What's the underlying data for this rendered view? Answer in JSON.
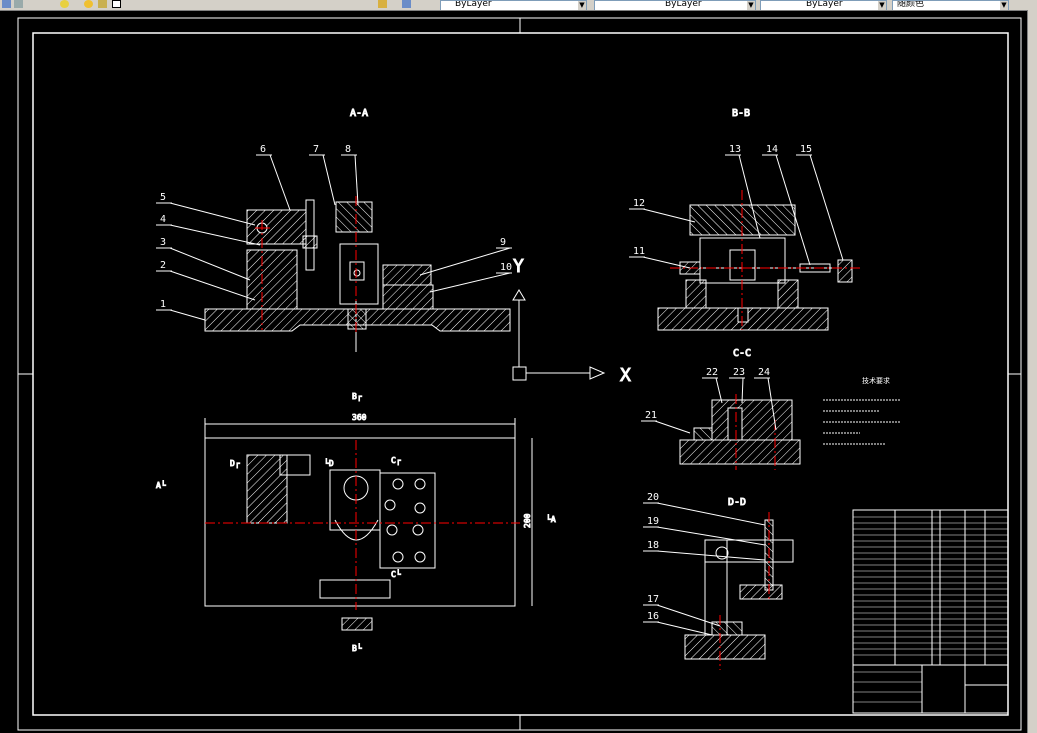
{
  "toolbar": {
    "layer_dropdown": "ByLayer",
    "color_dropdown": "ByLayer",
    "linetype_dropdown": "ByLayer",
    "lineweight_dropdown": "随颜色",
    "icons": [
      "layer-icon",
      "layer-state-icon",
      "lightbulb-icon",
      "sun-icon",
      "lock-icon",
      "color-swatch-icon",
      "match-properties-icon",
      "layer-previous-icon"
    ]
  },
  "views": {
    "aa": "A-A",
    "bb": "B-B",
    "cc": "C-C",
    "dd": "D-D",
    "b_top": "B┌",
    "b_bottom": "B└",
    "a_left": "A└",
    "a_right": "└A",
    "d_mark": "D┌",
    "d_mark2": "└D",
    "c_top": "C┌",
    "c_bottom": "C└"
  },
  "dimensions": {
    "width": "360",
    "height": "200"
  },
  "ucs": {
    "x": "X",
    "y": "Y"
  },
  "balloons": [
    "1",
    "2",
    "3",
    "4",
    "5",
    "6",
    "7",
    "8",
    "9",
    "10",
    "11",
    "12",
    "13",
    "14",
    "15",
    "16",
    "17",
    "18",
    "19",
    "20",
    "21",
    "22",
    "23",
    "24"
  ],
  "tech_req_title": "技术要求",
  "colors": {
    "background": "#000000",
    "lines": "#ffffff",
    "centerline": "#ff0000",
    "toolbar": "#d4d0c8"
  }
}
